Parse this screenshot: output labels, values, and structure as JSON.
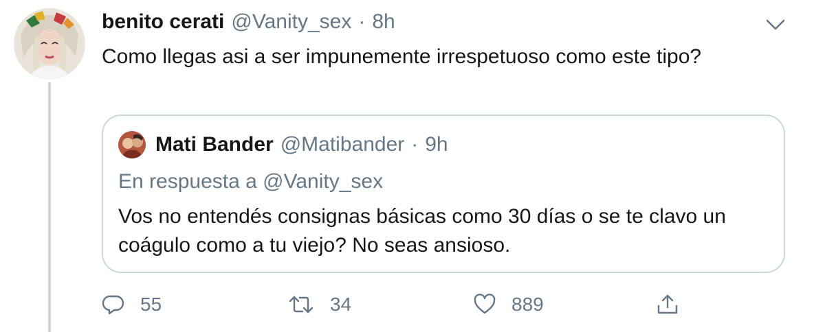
{
  "tweet": {
    "display_name": "benito cerati",
    "handle": "@Vanity_sex",
    "separator": "·",
    "time": "8h",
    "text": "Como llegas asi a ser impunemente irrespetuoso como este tipo?",
    "avatar_icon": "user-avatar-photo",
    "menu_icon": "chevron-down-icon"
  },
  "quoted_tweet": {
    "display_name": "Mati Bander",
    "handle": "@Matibander",
    "separator": "·",
    "time": "9h",
    "reply_to": "En respuesta a @Vanity_sex",
    "text": "Vos no entendés consignas básicas como 30 días o se te clavo un coágulo como a tu viejo? No seas ansioso.",
    "avatar_icon": "user-avatar-photo"
  },
  "actions": {
    "reply": {
      "icon": "reply-icon",
      "count": "55"
    },
    "retweet": {
      "icon": "retweet-icon",
      "count": "34"
    },
    "like": {
      "icon": "heart-icon",
      "count": "889"
    },
    "share": {
      "icon": "share-icon"
    }
  },
  "colors": {
    "text_primary": "#14171a",
    "text_secondary": "#657786",
    "border": "#ccd6dd"
  }
}
